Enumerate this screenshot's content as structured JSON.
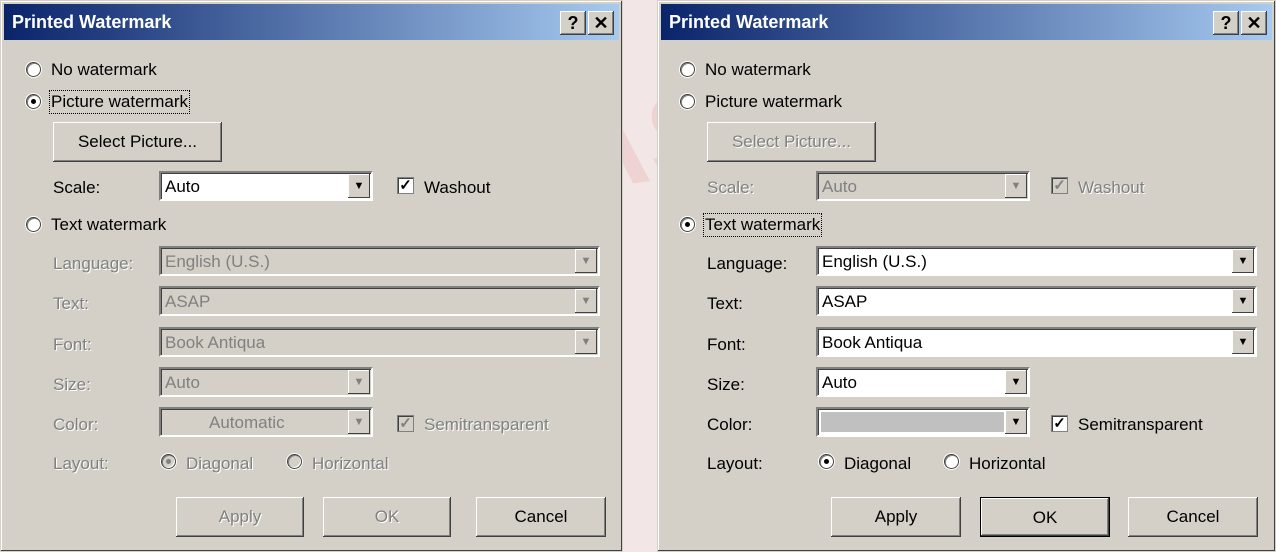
{
  "left_dialog": {
    "title": "Printed Watermark",
    "help_btn": "?",
    "close_btn": "✕",
    "no_watermark": "No watermark",
    "picture_watermark": "Picture watermark",
    "select_picture": "Select Picture...",
    "scale_label": "Scale:",
    "scale_value": "Auto",
    "washout": "Washout",
    "text_watermark": "Text watermark",
    "language_label": "Language:",
    "language_value": "English (U.S.)",
    "text_label": "Text:",
    "text_value": "ASAP",
    "font_label": "Font:",
    "font_value": "Book Antiqua",
    "size_label": "Size:",
    "size_value": "Auto",
    "color_label": "Color:",
    "color_value": "Automatic",
    "semitransparent": "Semitransparent",
    "layout_label": "Layout:",
    "diagonal": "Diagonal",
    "horizontal": "Horizontal",
    "apply": "Apply",
    "ok": "OK",
    "cancel": "Cancel"
  },
  "right_dialog": {
    "title": "Printed Watermark",
    "help_btn": "?",
    "close_btn": "✕",
    "no_watermark": "No watermark",
    "picture_watermark": "Picture watermark",
    "select_picture": "Select Picture...",
    "scale_label": "Scale:",
    "scale_value": "Auto",
    "washout": "Washout",
    "text_watermark": "Text watermark",
    "language_label": "Language:",
    "language_value": "English (U.S.)",
    "text_label": "Text:",
    "text_value": "ASAP",
    "font_label": "Font:",
    "font_value": "Book Antiqua",
    "size_label": "Size:",
    "size_value": "Auto",
    "color_label": "Color:",
    "color_value": "",
    "semitransparent": "Semitransparent",
    "layout_label": "Layout:",
    "diagonal": "Diagonal",
    "horizontal": "Horizontal",
    "apply": "Apply",
    "ok": "OK",
    "cancel": "Cancel"
  },
  "colors": {
    "titlebar_start": "#0a246a",
    "titlebar_end": "#a6caf0",
    "dialog_bg": "#d4d0c8",
    "color_swatch": "#c0c0c0"
  }
}
